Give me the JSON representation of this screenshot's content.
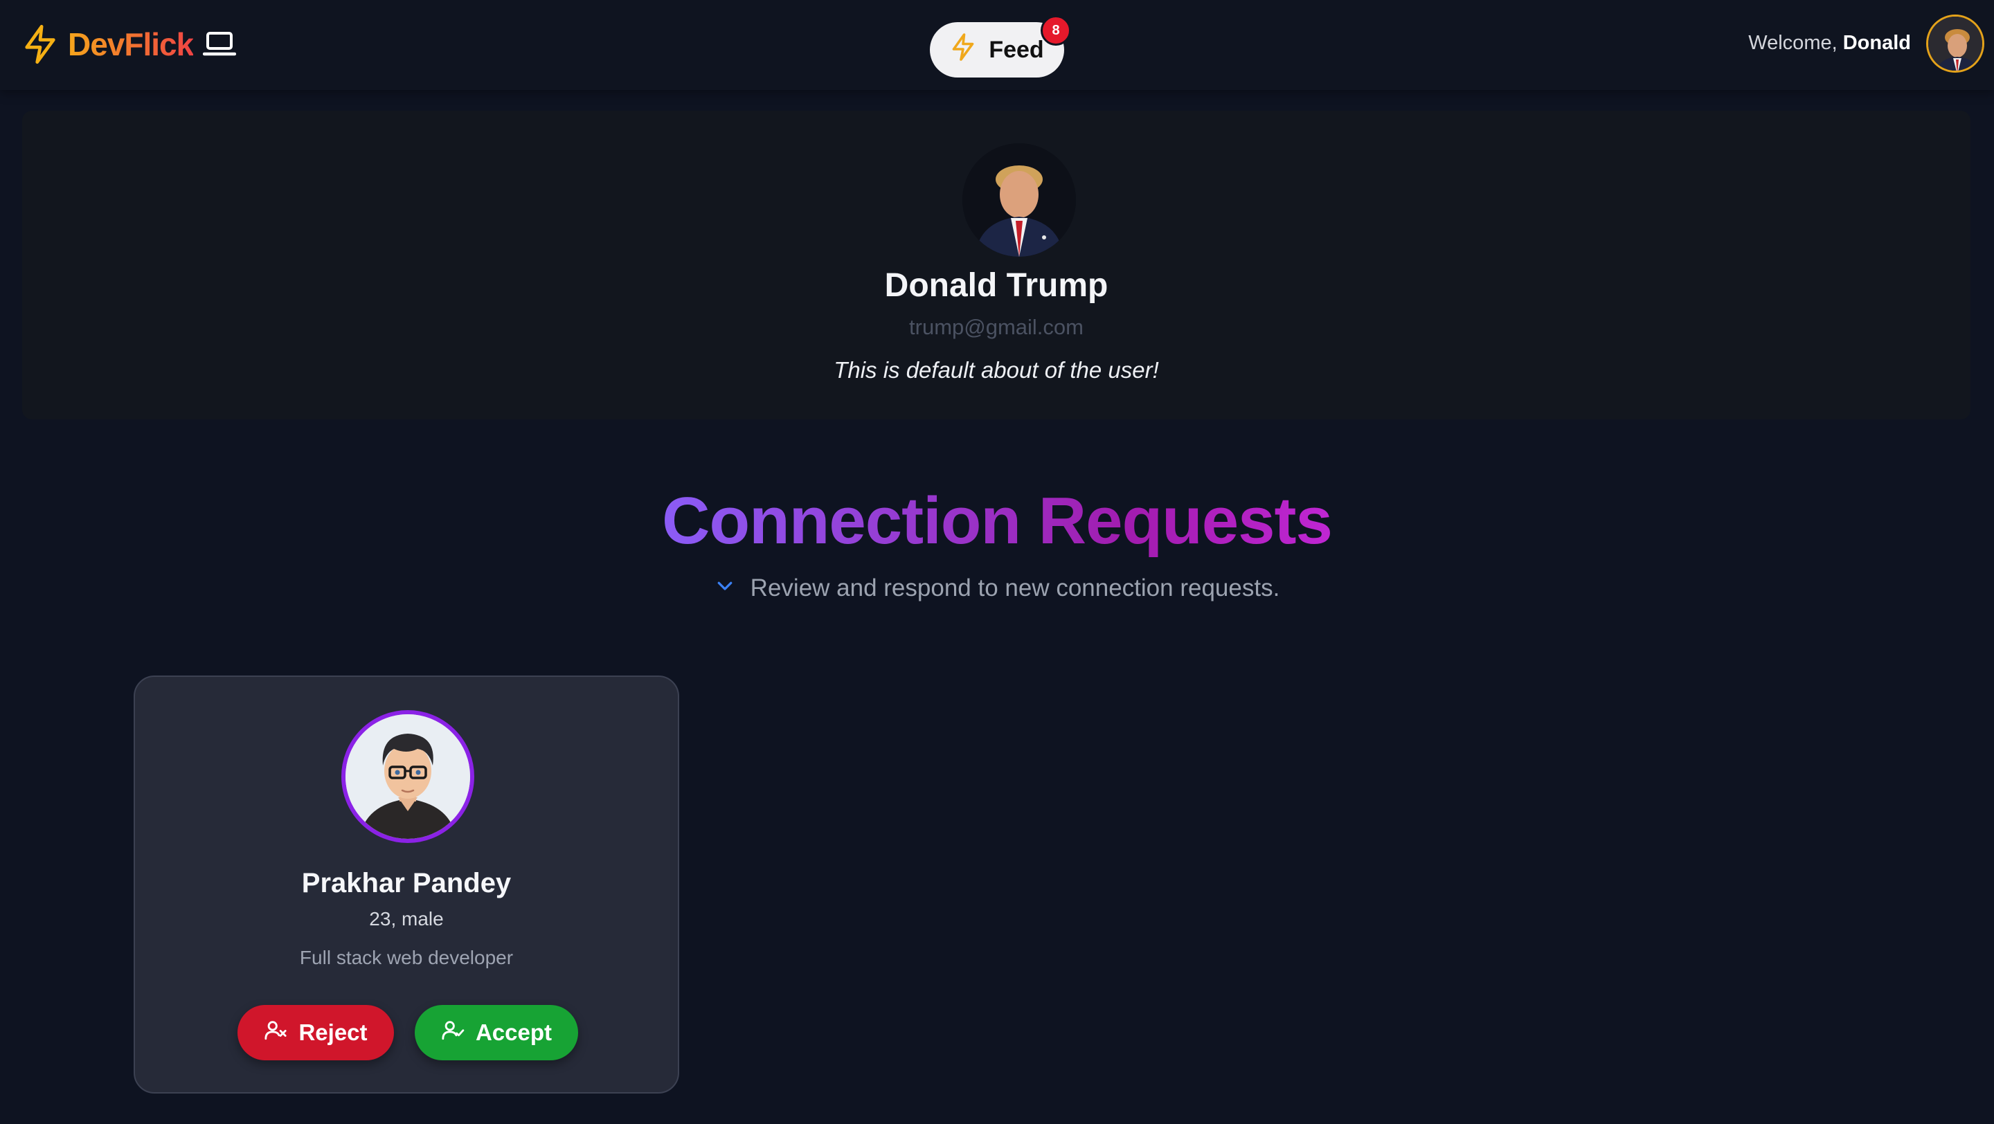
{
  "navbar": {
    "brand": "DevFlick",
    "feed_label": "Feed",
    "feed_badge": "8",
    "welcome_prefix": "Welcome,",
    "welcome_name": "Donald"
  },
  "profile": {
    "name": "Donald Trump",
    "email": "trump@gmail.com",
    "about": "This is default about of the user!"
  },
  "requests_section": {
    "title": "Connection Requests",
    "subtitle": "Review and respond to new connection requests."
  },
  "requests": [
    {
      "name": "Prakhar Pandey",
      "meta": "23, male",
      "about": "Full stack web developer",
      "reject_label": "Reject",
      "accept_label": "Accept"
    }
  ],
  "colors": {
    "background": "#0e1321",
    "brand_gradient_start": "#f5a51c",
    "brand_gradient_end": "#ef4444",
    "title_gradient_start": "#8b5cf6",
    "title_gradient_end": "#c026d3",
    "reject": "#d0162b",
    "accept": "#17a334",
    "badge": "#e5192b"
  },
  "icons": {
    "brand": "lightning-bolt-icon",
    "brand_secondary": "laptop-icon",
    "feed": "lightning-bolt-icon",
    "subtitle": "chevron-down-icon",
    "reject": "user-x-icon",
    "accept": "user-check-icon"
  }
}
